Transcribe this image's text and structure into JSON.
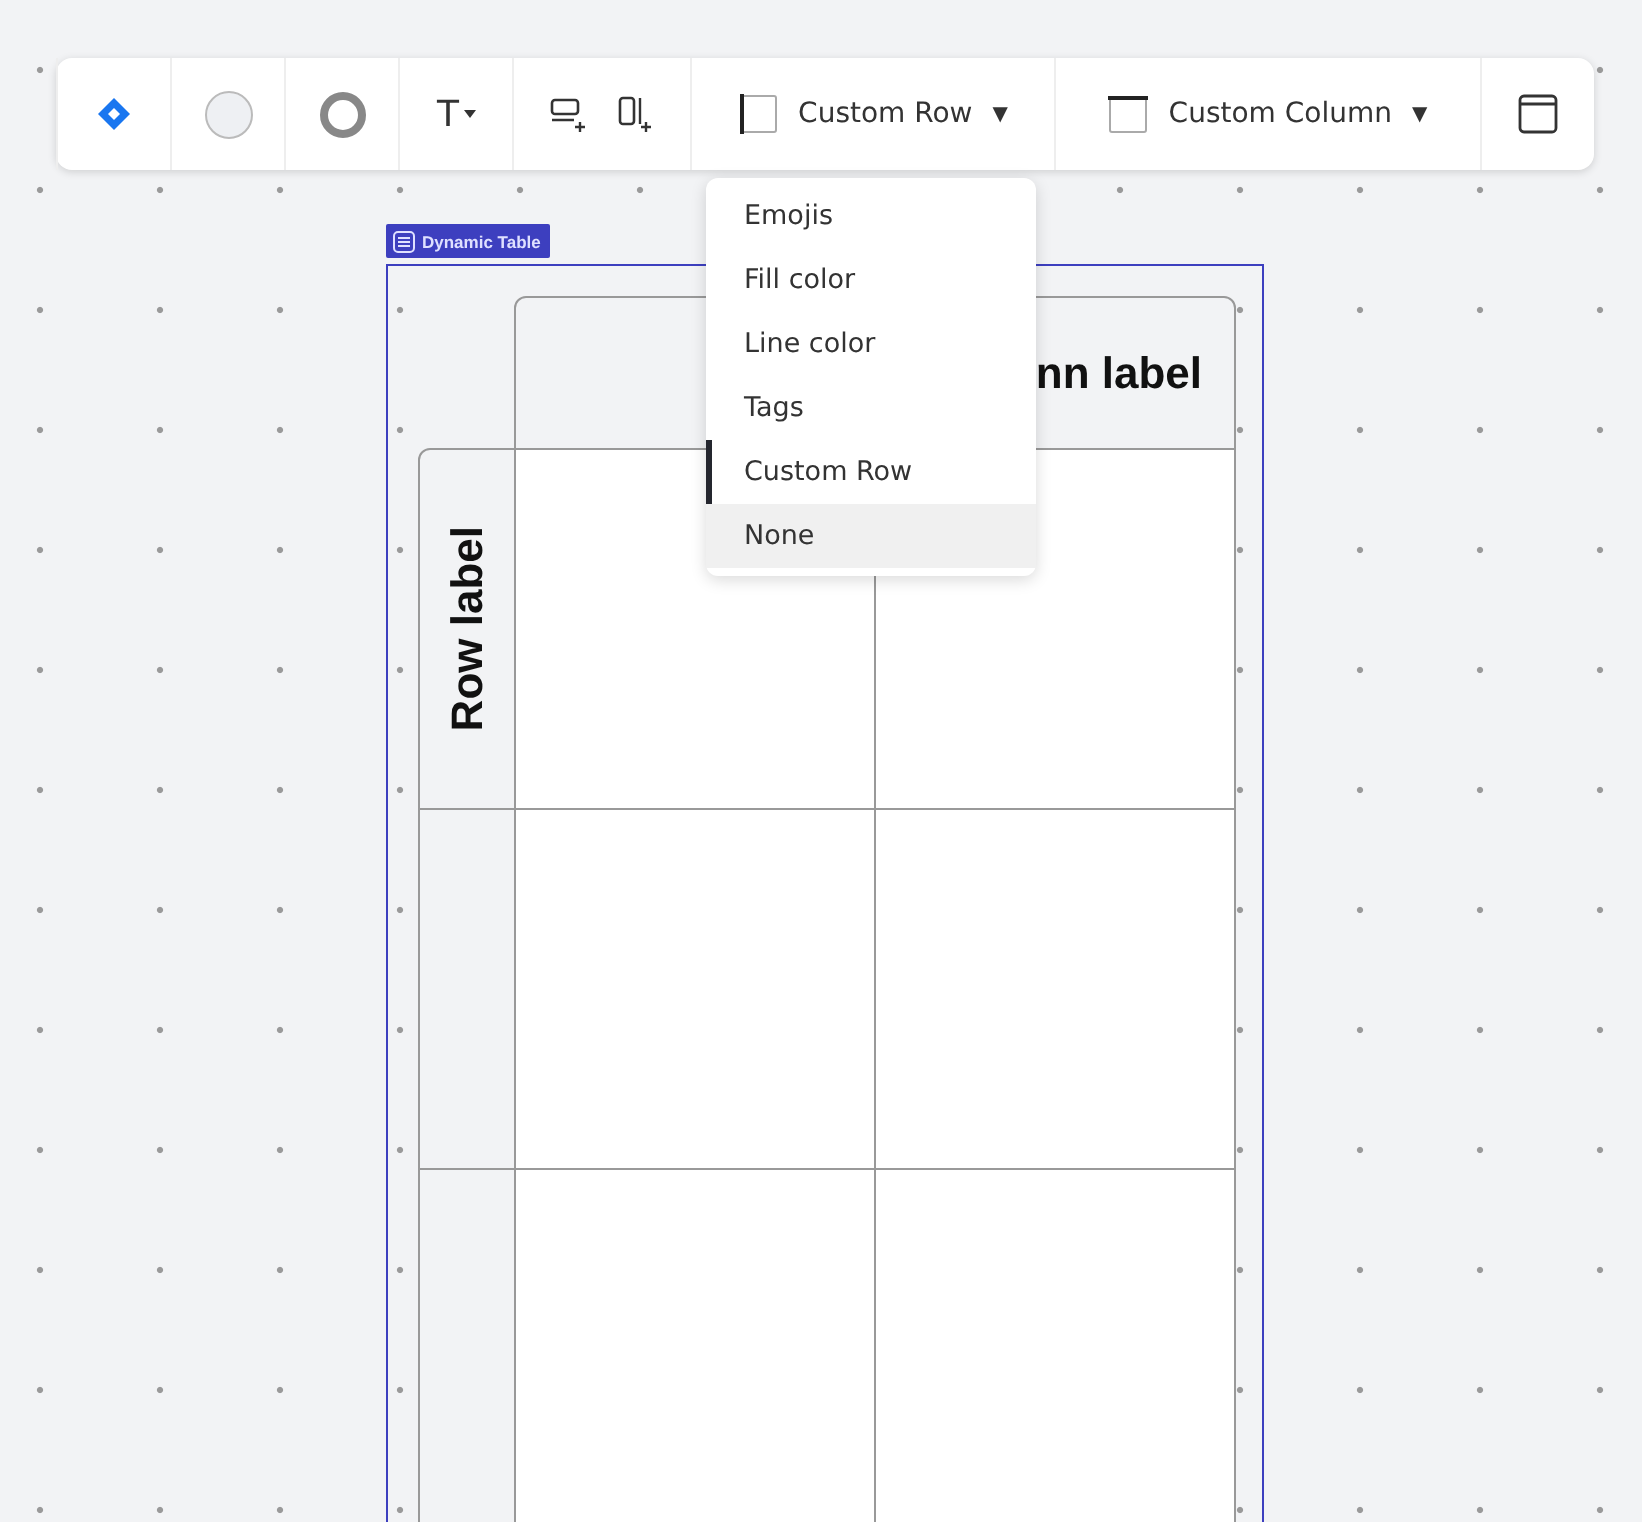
{
  "toolbar": {
    "text_tool": "T",
    "row_dropdown": {
      "label": "Custom Row",
      "caret": "▼"
    },
    "column_dropdown": {
      "label": "Custom Column",
      "caret": "▼"
    }
  },
  "menu": {
    "items": [
      {
        "label": "Emojis",
        "selected": false,
        "hovered": false
      },
      {
        "label": "Fill color",
        "selected": false,
        "hovered": false
      },
      {
        "label": "Line color",
        "selected": false,
        "hovered": false
      },
      {
        "label": "Tags",
        "selected": false,
        "hovered": false
      },
      {
        "label": "Custom Row",
        "selected": true,
        "hovered": false
      },
      {
        "label": "None",
        "selected": false,
        "hovered": true
      }
    ]
  },
  "table": {
    "tag": "Dynamic Table",
    "column_label": "nn label",
    "row_label": "Row label"
  }
}
